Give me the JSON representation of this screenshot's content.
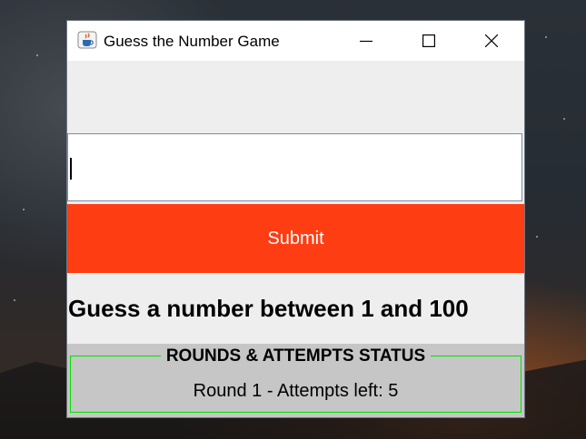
{
  "window": {
    "title": "Guess the Number Game",
    "app_icon": "java-cup-icon",
    "controls": {
      "minimize_icon": "minimize-icon",
      "maximize_icon": "maximize-icon",
      "close_icon": "close-icon"
    }
  },
  "form": {
    "guess_input_value": "",
    "submit_label": "Submit",
    "submit_color": "#ff3d12"
  },
  "prompt": "Guess a number between 1 and 100",
  "status": {
    "title": "ROUNDS & ATTEMPTS STATUS",
    "text": "Round 1 - Attempts left: 5",
    "border_color": "#00e000"
  }
}
